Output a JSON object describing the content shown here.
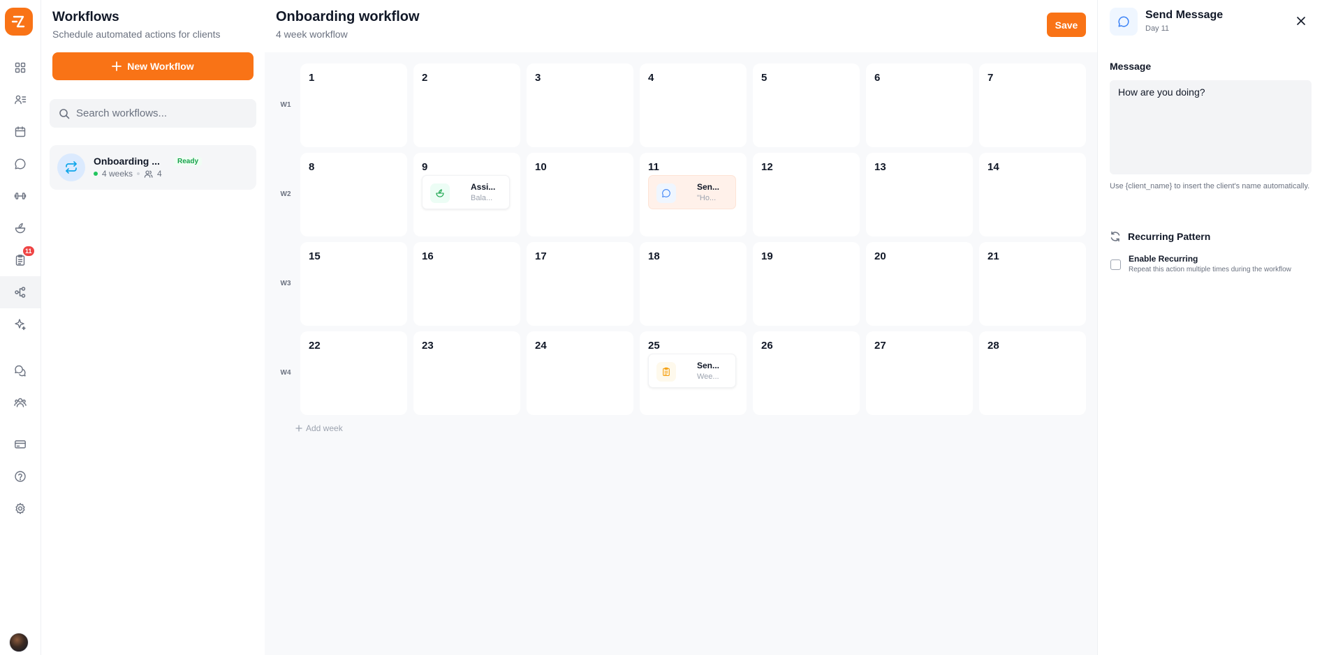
{
  "rail": {
    "items": [
      {
        "icon": "dashboard-grid-icon"
      },
      {
        "icon": "clients-list-icon"
      },
      {
        "icon": "calendar-icon"
      },
      {
        "icon": "chat-bubble-icon"
      },
      {
        "icon": "dumbbell-icon"
      },
      {
        "icon": "nutrition-bowl-icon"
      },
      {
        "icon": "clipboard-icon",
        "badge": "11"
      },
      {
        "icon": "workflow-nodes-icon"
      },
      {
        "icon": "sparkle-icon"
      },
      {
        "icon": "community-chat-icon"
      },
      {
        "icon": "team-icon"
      },
      {
        "icon": "billing-card-icon"
      },
      {
        "icon": "help-circle-icon"
      },
      {
        "icon": "settings-gear-icon"
      }
    ]
  },
  "sidebar": {
    "title": "Workflows",
    "subtitle": "Schedule automated actions for clients",
    "new_button": "New Workflow",
    "search_placeholder": "Search workflows...",
    "workflows": [
      {
        "name": "Onboarding ...",
        "status": "Ready",
        "weeks": "4 weeks",
        "clients": "4"
      }
    ]
  },
  "main": {
    "title": "Onboarding workflow",
    "subtitle": "4 week workflow",
    "save_label": "Save",
    "add_week_label": "Add week",
    "weeks": [
      {
        "label": "W1",
        "days": [
          {
            "num": "1"
          },
          {
            "num": "2"
          },
          {
            "num": "3"
          },
          {
            "num": "4"
          },
          {
            "num": "5"
          },
          {
            "num": "6"
          },
          {
            "num": "7"
          }
        ]
      },
      {
        "label": "W2",
        "days": [
          {
            "num": "8"
          },
          {
            "num": "9",
            "action": {
              "title": "Assi...",
              "sub": "Bala...",
              "icon": "nutrition-bowl-icon",
              "tint": "#ecfdf5",
              "color": "#16a34a"
            }
          },
          {
            "num": "10"
          },
          {
            "num": "11",
            "action": {
              "title": "Sen...",
              "sub": "\"Ho...",
              "icon": "chat-bubble-icon",
              "tint": "#eff6ff",
              "color": "#3b82f6",
              "selected": true
            }
          },
          {
            "num": "12"
          },
          {
            "num": "13"
          },
          {
            "num": "14"
          }
        ]
      },
      {
        "label": "W3",
        "days": [
          {
            "num": "15"
          },
          {
            "num": "16"
          },
          {
            "num": "17"
          },
          {
            "num": "18"
          },
          {
            "num": "19"
          },
          {
            "num": "20"
          },
          {
            "num": "21"
          }
        ]
      },
      {
        "label": "W4",
        "days": [
          {
            "num": "22"
          },
          {
            "num": "23"
          },
          {
            "num": "24"
          },
          {
            "num": "25",
            "action": {
              "title": "Sen...",
              "sub": "Wee...",
              "icon": "clipboard-icon",
              "tint": "#fef9ec",
              "color": "#f59e0b"
            }
          },
          {
            "num": "26"
          },
          {
            "num": "27"
          },
          {
            "num": "28"
          }
        ]
      }
    ]
  },
  "panel": {
    "title": "Send Message",
    "day": "Day 11",
    "message_label": "Message",
    "message_value": "How are you doing?",
    "help_text": "Use {client_name} to insert the client's name automatically.",
    "recurring_title": "Recurring Pattern",
    "enable_label": "Enable Recurring",
    "enable_desc": "Repeat this action multiple times during the workflow",
    "enable_checked": false
  },
  "colors": {
    "accent": "#f97316",
    "ready": "#16a34a",
    "badge": "#ef4444"
  }
}
